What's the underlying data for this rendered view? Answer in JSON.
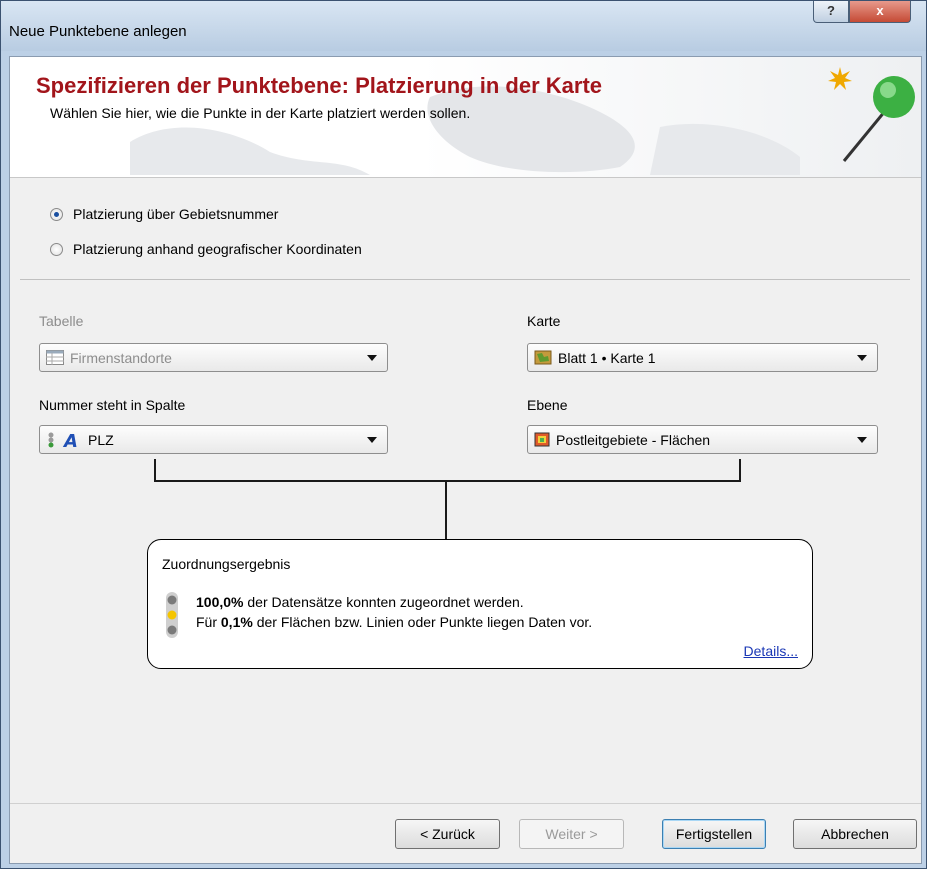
{
  "window": {
    "title": "Neue Punktebene anlegen",
    "help_label": "?",
    "close_label": "x"
  },
  "header": {
    "title": "Spezifizieren der Punktebene: Platzierung in der Karte",
    "subtitle": "Wählen Sie hier, wie die Punkte in der Karte platziert werden sollen."
  },
  "placement": {
    "options": [
      {
        "label": "Platzierung über Gebietsnummer",
        "selected": true
      },
      {
        "label": "Platzierung anhand geografischer Koordinaten",
        "selected": false
      }
    ]
  },
  "table": {
    "label": "Tabelle",
    "value": "Firmenstandorte",
    "enabled": false,
    "icon": "table-icon"
  },
  "map": {
    "label": "Karte",
    "value": "Blatt 1 • Karte 1",
    "icon": "map-icon"
  },
  "column": {
    "label": "Nummer steht in Spalte",
    "value": "PLZ",
    "icon": "text-column-icon"
  },
  "layer": {
    "label": "Ebene",
    "value": "Postleitgebiete - Flächen",
    "icon": "area-layer-icon"
  },
  "result": {
    "title": "Zuordnungsergebnis",
    "line1_value": "100,0%",
    "line1_text": " der Datensätze konnten zugeordnet werden.",
    "line2_prefix": "Für ",
    "line2_value": "0,1%",
    "line2_text": " der Flächen bzw. Linien oder Punkte liegen Daten vor.",
    "details_link": "Details...",
    "status_light": "yellow"
  },
  "buttons": {
    "back": "< Zurück",
    "next": "Weiter >",
    "finish": "Fertigstellen",
    "cancel": "Abbrechen"
  },
  "colors": {
    "title_red": "#a2151b",
    "link_blue": "#1a37b5",
    "pin_green": "#3cb043"
  }
}
